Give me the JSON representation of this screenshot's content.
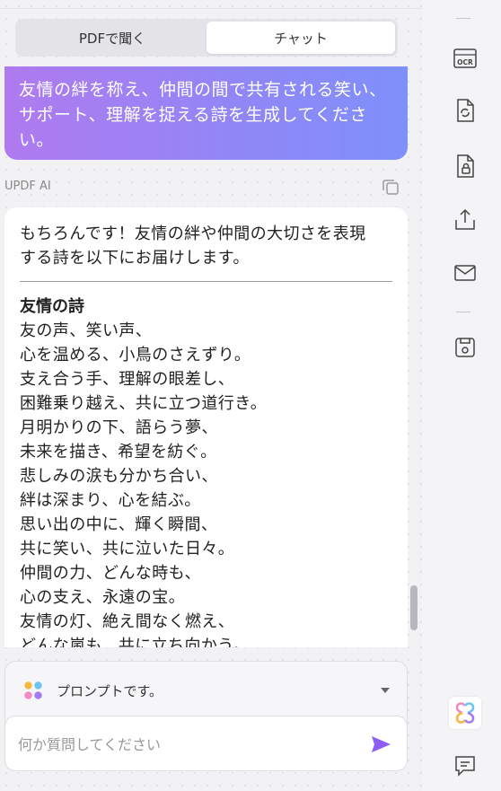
{
  "tabs": [
    {
      "label": "PDFで聞く",
      "active": false
    },
    {
      "label": "チャット",
      "active": true
    }
  ],
  "user_message": {
    "text": "友情の絆を称え、仲間の間で共有される笑い、サポート、理解を捉える詩を生成してください。",
    "lines": [
      "友情の絆を称え、仲間の間で共有される笑い、",
      "サポート、理解を捉える詩を生成してくださ",
      "い。"
    ]
  },
  "assistant": {
    "label": "UPDF AI",
    "intro_lines": [
      "もちろんです！友情の絆や仲間の大切さを表現",
      "する詩を以下にお届けします。"
    ],
    "poem_title": "友情の詩",
    "poem_lines": [
      "友の声、笑い声、",
      "心を温める、小鳥のさえずり。",
      "支え合う手、理解の眼差し、",
      "困難乗り越え、共に立つ道行き。",
      "月明かりの下、語らう夢、",
      "未来を描き、希望を紡ぐ。",
      "悲しみの涙も分かち合い、",
      "絆は深まり、心を結ぶ。",
      "思い出の中に、輝く瞬間、",
      "共に笑い、共に泣いた日々。",
      "仲間の力、どんな時も、",
      "心の支え、永遠の宝。",
      "友情の灯、絶え間なく燃え、",
      "どんな嵐も、共に立ち向かう。"
    ]
  },
  "composer": {
    "prompt_label": "プロンプトです。",
    "input_placeholder": "何か質問してください",
    "input_value": ""
  },
  "sidebar": {
    "ocr_label": "OCR"
  },
  "colors": {
    "gradient_start": "#b07af0",
    "gradient_end": "#7e90fa",
    "send": "#8b5cf6"
  }
}
